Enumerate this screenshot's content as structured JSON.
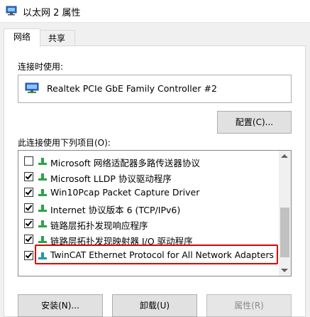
{
  "window": {
    "title": "以太网 2 属性"
  },
  "tabs": [
    {
      "label": "网络",
      "active": true
    },
    {
      "label": "共享",
      "active": false
    }
  ],
  "connect_using_label": "连接时使用:",
  "adapter": {
    "name": "Realtek PCIe GbE Family Controller #2",
    "icon": "network-adapter-icon"
  },
  "configure_button": "配置(C)...",
  "items_label": "此连接使用下列项目(O):",
  "items": [
    {
      "label": "Microsoft 网络适配器多路传送器协议",
      "checked": false,
      "icon": "protocol-icon"
    },
    {
      "label": "Microsoft LLDP 协议驱动程序",
      "checked": true,
      "icon": "protocol-icon"
    },
    {
      "label": "Win10Pcap Packet Capture Driver",
      "checked": true,
      "icon": "protocol-icon"
    },
    {
      "label": "Internet 协议版本 6 (TCP/IPv6)",
      "checked": true,
      "icon": "protocol-icon"
    },
    {
      "label": "链路层拓扑发现响应程序",
      "checked": true,
      "icon": "protocol-icon"
    },
    {
      "label": "链路层拓扑发现映射器 I/O 驱动程序",
      "checked": true,
      "icon": "protocol-icon"
    },
    {
      "label": "TwinCAT Ethernet Protocol for All Network Adapters",
      "checked": true,
      "icon": "protocol-icon"
    }
  ],
  "buttons": {
    "install": "安装(N)...",
    "uninstall": "卸载(U)",
    "properties": "属性(R)"
  },
  "colors": {
    "highlight": "#e00000",
    "icon_green": "#2aa34a"
  }
}
